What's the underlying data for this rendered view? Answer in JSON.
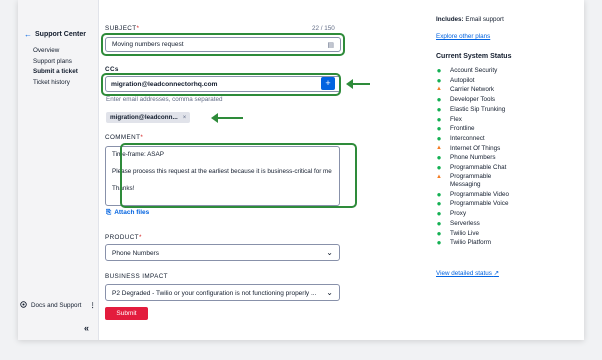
{
  "sidebar": {
    "back_label": "Support Center",
    "items": [
      "Overview",
      "Support plans",
      "Submit a ticket",
      "Ticket history"
    ],
    "footer_label": "Docs and Support",
    "footer_menu": "⋮",
    "collapse_icon": "«"
  },
  "form": {
    "subject_label": "SUBJECT",
    "subject_counter": "22 / 150",
    "subject_value": "Moving numbers request",
    "cc_label": "CCs",
    "cc_value": "migration@leadconnectorhq.com",
    "cc_add": "+",
    "cc_help": "Enter email addresses, comma separated",
    "cc_chip": "migration@leadconn...",
    "cc_chip_remove": "×",
    "comment_label": "COMMENT",
    "comment_lines": [
      "Time-frame: ASAP",
      "",
      "Please process this request at the earliest because it is business-critical for me",
      "",
      "Thanks!"
    ],
    "attach_label": "Attach files",
    "product_label": "PRODUCT",
    "product_value": "Phone Numbers",
    "impact_label": "BUSINESS IMPACT",
    "impact_value": "P2 Degraded - Twilio or your configuration is not functioning properly ...",
    "submit_label": "Submit",
    "required_mark": "*"
  },
  "right": {
    "includes_label": "Includes:",
    "includes_value": "Email support",
    "explore_link": "Explore other plans",
    "status_title": "Current System Status",
    "status_items": [
      {
        "name": "Account Security",
        "state": "ok"
      },
      {
        "name": "Autopilot",
        "state": "ok"
      },
      {
        "name": "Carrier Network",
        "state": "warn"
      },
      {
        "name": "Developer Tools",
        "state": "ok"
      },
      {
        "name": "Elastic Sip Trunking",
        "state": "ok"
      },
      {
        "name": "Flex",
        "state": "ok"
      },
      {
        "name": "Frontline",
        "state": "ok"
      },
      {
        "name": "Interconnect",
        "state": "ok"
      },
      {
        "name": "Internet Of Things",
        "state": "warn"
      },
      {
        "name": "Phone Numbers",
        "state": "ok"
      },
      {
        "name": "Programmable Chat",
        "state": "ok"
      },
      {
        "name": "Programmable Messaging",
        "state": "warn"
      },
      {
        "name": "Programmable Video",
        "state": "ok"
      },
      {
        "name": "Programmable Voice",
        "state": "ok"
      },
      {
        "name": "Proxy",
        "state": "ok"
      },
      {
        "name": "Serverless",
        "state": "ok"
      },
      {
        "name": "Twilio Live",
        "state": "ok"
      },
      {
        "name": "Twilio Platform",
        "state": "ok"
      }
    ],
    "detail_link": "View detailed status"
  },
  "colors": {
    "highlight": "#2e8b3a",
    "ok": "#14b053",
    "warn": "#f47c22",
    "link": "#0263e0",
    "submit": "#e31c3d"
  }
}
